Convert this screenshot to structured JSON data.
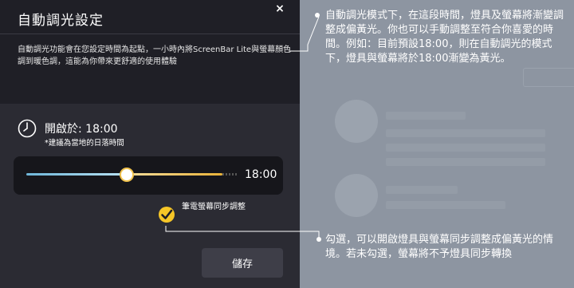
{
  "dialog": {
    "title": "自動調光設定",
    "close_label": "×",
    "description": "自動調光功能會在您設定時間為起點，一小時內將ScreenBar Lite與螢幕顏色調到暖色調，這能為你帶來更舒適的使用體驗",
    "start_time_label": "開啟於: 18:00",
    "hint": "*建議為當地的日落時間",
    "slider_value": "18:00",
    "slider_fraction": 0.4,
    "sync_label": "筆電螢幕同步調整",
    "sync_checked": true,
    "save_label": "儲存"
  },
  "callouts": {
    "top": "自動調光模式下，在這段時間，燈具及螢幕將漸變調整成偏黃光。你也可以手動調整至符合你喜愛的時間。例如：目前預設18:00，則在自動調光的模式下，燈具與螢幕將於18:00漸變為黃光。",
    "bottom": "勾選，可以開啟燈具與螢幕同步調整成偏黃光的情境。若未勾選，螢幕將不予燈具同步轉換"
  },
  "colors": {
    "accent_yellow": "#f6c627",
    "dialog_bg": "#2b2b33",
    "overlay_bg": "#8d95a1"
  }
}
